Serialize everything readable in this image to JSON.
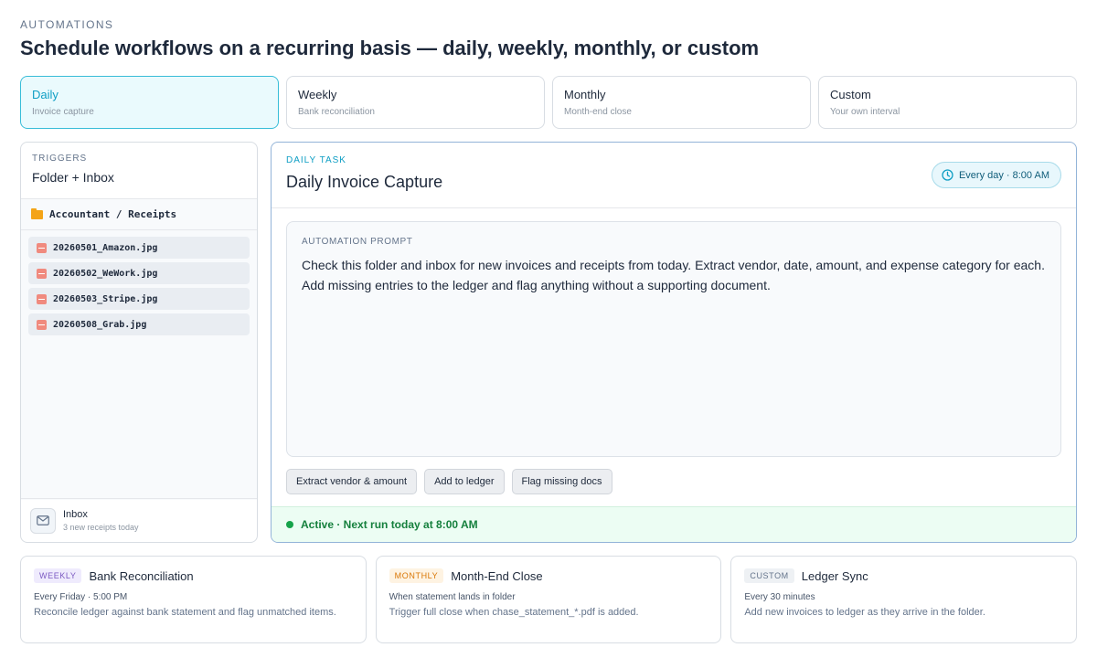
{
  "header": {
    "eyebrow": "AUTOMATIONS",
    "title": "Schedule workflows on a recurring basis — daily, weekly, monthly, or custom"
  },
  "tabs": [
    {
      "label": "Daily",
      "sub": "Invoice capture",
      "active": true
    },
    {
      "label": "Weekly",
      "sub": "Bank reconciliation",
      "active": false
    },
    {
      "label": "Monthly",
      "sub": "Month-end close",
      "active": false
    },
    {
      "label": "Custom",
      "sub": "Your own interval",
      "active": false
    }
  ],
  "triggers": {
    "eyebrow": "TRIGGERS",
    "title": "Folder + Inbox",
    "folder": "Accountant / Receipts",
    "files": [
      "20260501_Amazon.jpg",
      "20260502_WeWork.jpg",
      "20260503_Stripe.jpg",
      "20260508_Grab.jpg"
    ],
    "inbox_title": "Inbox",
    "inbox_sub": "3 new receipts today"
  },
  "task": {
    "eyebrow": "DAILY TASK",
    "title": "Daily Invoice Capture",
    "schedule": "Every day · 8:00 AM",
    "prompt_label": "AUTOMATION PROMPT",
    "prompt": "Check this folder and inbox for new invoices and receipts from today. Extract vendor, date, amount, and expense category for each. Add missing entries to the ledger and flag anything without a supporting document.",
    "chips": [
      "Extract vendor & amount",
      "Add to ledger",
      "Flag missing docs"
    ],
    "status": "Active · Next run today at 8:00 AM"
  },
  "cards": [
    {
      "badge": "WEEKLY",
      "title": "Bank Reconciliation",
      "schedule": "Every Friday · 5:00 PM",
      "desc": "Reconcile ledger against bank statement and flag unmatched items."
    },
    {
      "badge": "MONTHLY",
      "title": "Month-End Close",
      "schedule": "When statement lands in folder",
      "desc": "Trigger full close when chase_statement_*.pdf is added."
    },
    {
      "badge": "CUSTOM",
      "title": "Ledger Sync",
      "schedule": "Every 30 minutes",
      "desc": "Add new invoices to ledger as they arrive in the folder."
    }
  ],
  "colors": {
    "accent": "#0e9ec4",
    "active_status": "#15803d",
    "file_icon": "#f08a7e",
    "folder_icon": "#f4a417"
  }
}
